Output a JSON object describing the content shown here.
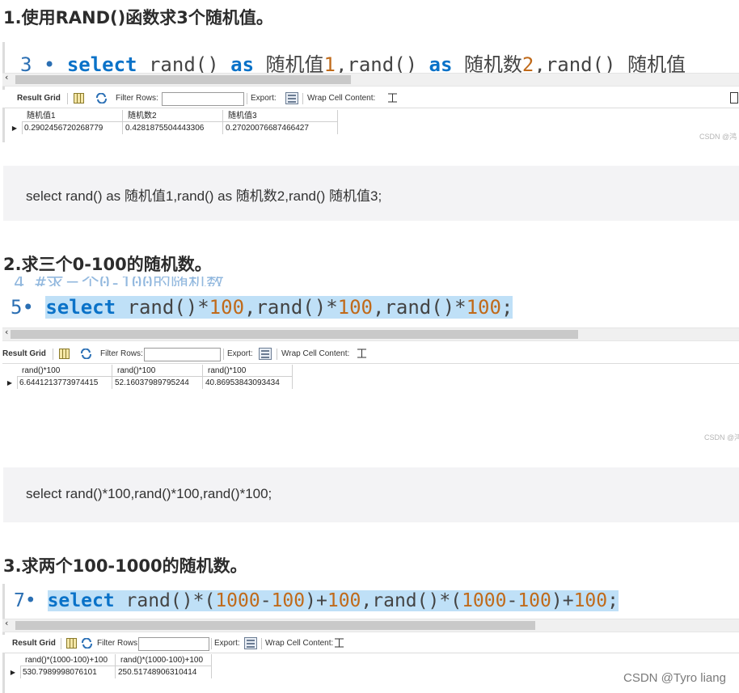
{
  "section1": {
    "heading": "1.使用RAND()函数求3个随机值。",
    "code": {
      "line_no": "3",
      "select": "select",
      "rand1": "rand()",
      "as1": "as",
      "alias1": "随机值",
      "alias1_num": "1",
      "comma1": ",",
      "rand2": "rand()",
      "as2": "as",
      "alias2": "随机数",
      "alias2_num": "2",
      "comma2": ",",
      "rand3": "rand()",
      "alias3": "随机值"
    },
    "toolbar": {
      "result_grid": "Result Grid",
      "filter_rows": "Filter Rows:",
      "export": "Export:",
      "wrap": "Wrap Cell Content:"
    },
    "columns": [
      "随机值1",
      "随机数2",
      "随机值3"
    ],
    "row": [
      "0.2902456720268779",
      "0.4281875504443306",
      "0.27020076687466427"
    ],
    "watermark": "CSDN @鸿",
    "sql": "select rand() as 随机值1,rand() as 随机数2,rand() 随机值3;"
  },
  "section2": {
    "heading": "2.求三个0-100的随机数。",
    "faded_line": "4  #求三个0-100的随机数",
    "code": {
      "line_no": "5",
      "select": "select",
      "rand": "rand()",
      "op": "*",
      "n100": "100",
      "comma": ",",
      "semi": ";"
    },
    "toolbar": {
      "result_grid": "Result Grid",
      "filter_rows": "Filter Rows:",
      "export": "Export:",
      "wrap": "Wrap Cell Content:"
    },
    "columns": [
      "rand()*100",
      "rand()*100",
      "rand()*100"
    ],
    "row": [
      "6.6441213773974415",
      "52.16037989795244",
      "40.86953843093434"
    ],
    "watermark": "CSDN @鸿",
    "sql": "select rand()*100,rand()*100,rand()*100;"
  },
  "section3": {
    "heading": "3.求两个100-1000的随机数。",
    "code": {
      "line_no": "7",
      "select": "select",
      "rand": "rand()",
      "star": "*",
      "lp": "(",
      "n1000": "1000",
      "minus": "-",
      "n100": "100",
      "rp": ")",
      "plus": "+",
      "comma": ",",
      "semi": ";"
    },
    "toolbar": {
      "result_grid": "Result Grid",
      "filter_rows": "Filter Rows:",
      "export": "Export:",
      "wrap": "Wrap Cell Content:"
    },
    "columns": [
      "rand()*(1000-100)+100",
      "rand()*(1000-100)+100"
    ],
    "row": [
      "530.7989998076101",
      "250.51748906310414"
    ],
    "watermark": "CSDN @Tyro liang"
  }
}
